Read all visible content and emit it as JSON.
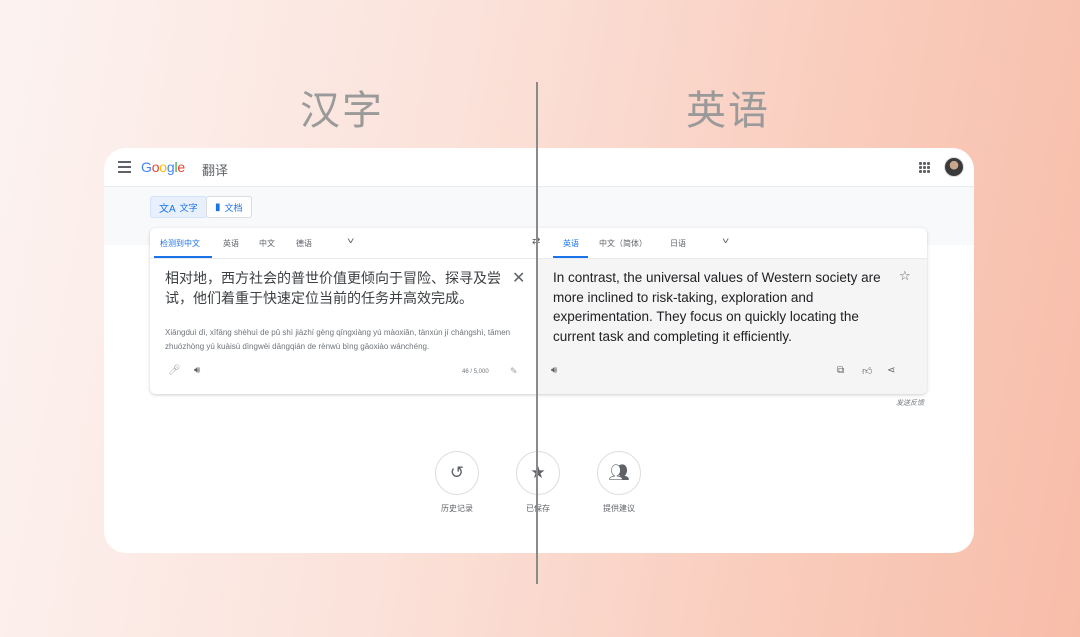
{
  "captions": {
    "left": "汉字",
    "right": "英语"
  },
  "header": {
    "logo_letters": [
      "G",
      "o",
      "o",
      "g",
      "l",
      "e"
    ],
    "product": "翻译"
  },
  "modes": [
    {
      "label": "文字",
      "icon": "translate-icon",
      "active": true
    },
    {
      "label": "文档",
      "icon": "document-icon",
      "active": false
    }
  ],
  "source": {
    "tabs": [
      "检测到中文",
      "英语",
      "中文",
      "德语"
    ],
    "active_tab": 0,
    "text": "相对地，西方社会的普世价值更倾向于冒险、探寻及尝试，他们着重于快速定位当前的任务并高效完成。",
    "pinyin": "Xiāngduì dì, xīfāng shèhuì de pǔ shì jiàzhí gèng qīngxiàng yú màoxiǎn, tànxún jí chángshì, tāmen zhuózhòng yú kuàisù dìngwèi dāngqián de rènwù bìng gāoxiào wánchéng.",
    "char_count": "46 / 5,000"
  },
  "target": {
    "tabs": [
      "英语",
      "中文（简体）",
      "日语"
    ],
    "active_tab": 0,
    "text": "In contrast, the universal values of Western society are more inclined to risk-taking, exploration and experimentation. They focus on quickly locating the current task and completing it efficiently."
  },
  "feedback": "发送反馈",
  "actions": [
    {
      "label": "历史记录",
      "icon": "history-icon"
    },
    {
      "label": "已保存",
      "icon": "star-icon"
    },
    {
      "label": "提供建议",
      "icon": "contribute-icon"
    }
  ],
  "colors": {
    "accent": "#1a73e8",
    "divider": "#8a8a8a"
  }
}
